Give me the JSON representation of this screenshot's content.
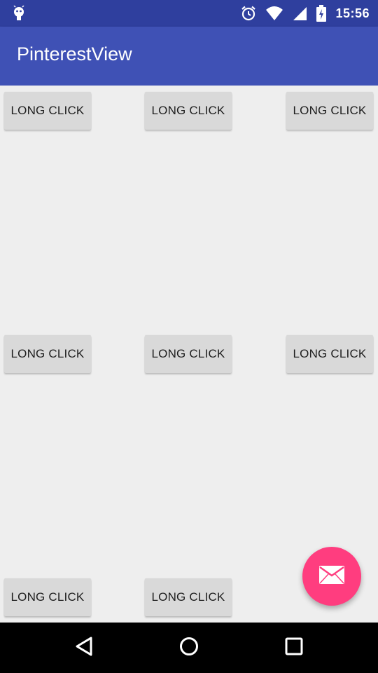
{
  "status_bar": {
    "time": "15:56",
    "icons": [
      "android-debug-icon",
      "alarm-icon",
      "wifi-icon",
      "signal-icon",
      "battery-icon"
    ]
  },
  "app_bar": {
    "title": "PinterestView"
  },
  "grid": {
    "buttons": [
      {
        "label": "LONG CLICK"
      },
      {
        "label": "LONG CLICK"
      },
      {
        "label": "LONG CLICK"
      },
      {
        "label": "LONG CLICK"
      },
      {
        "label": "LONG CLICK"
      },
      {
        "label": "LONG CLICK"
      },
      {
        "label": "LONG CLICK"
      },
      {
        "label": "LONG CLICK"
      }
    ]
  },
  "fab": {
    "icon": "email-icon",
    "color": "#FF3D7F"
  },
  "nav_bar": {
    "buttons": [
      "back-icon",
      "home-icon",
      "recents-icon"
    ]
  },
  "colors": {
    "primary": "#3F51B5",
    "primary_dark": "#2F3F9E",
    "accent": "#FF3D7F",
    "background": "#EEEEEE"
  }
}
